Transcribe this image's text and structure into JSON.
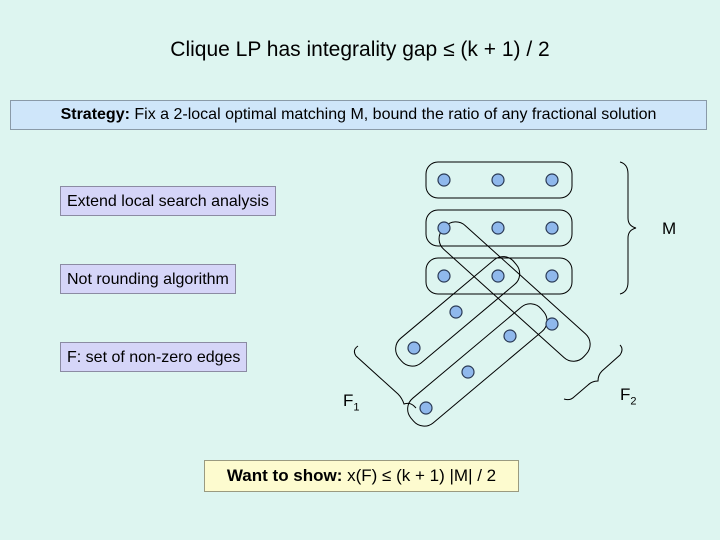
{
  "title": "Clique LP has integrality gap ≤ (k + 1) / 2",
  "strategy": {
    "label": "Strategy:",
    "text": " Fix a 2-local optimal matching M, bound the ratio of any fractional solution"
  },
  "notes": [
    "Extend local search analysis",
    "Not rounding algorithm",
    "F: set of non-zero edges"
  ],
  "want": {
    "label": "Want to show:",
    "text": " x(F) ≤ (k + 1) |M| / 2"
  },
  "diagram": {
    "labels": {
      "M": "M",
      "F1_base": "F",
      "F1_sub": "1",
      "F2_base": "F",
      "F2_sub": "2"
    },
    "vertex_color": "#8fb8ec",
    "matching_edges_count": 3,
    "vertices_per_edge": 3
  }
}
